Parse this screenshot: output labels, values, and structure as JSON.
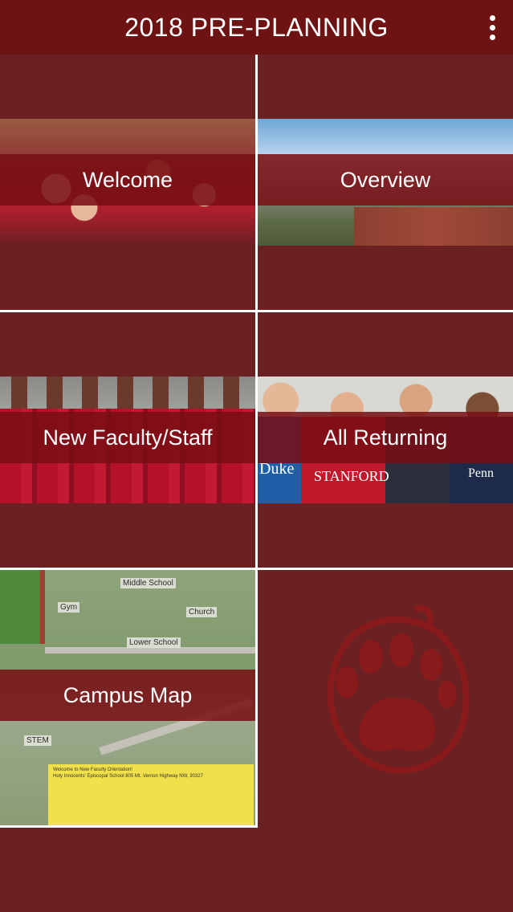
{
  "header": {
    "title": "2018 PRE-PLANNING",
    "menu_icon": "more-vertical-icon"
  },
  "tiles": [
    {
      "label": "Welcome"
    },
    {
      "label": "Overview"
    },
    {
      "label": "New Faculty/Staff"
    },
    {
      "label": "All Returning"
    },
    {
      "label": "Campus Map"
    }
  ],
  "returning_shirts": [
    "Duke",
    "STANFORD",
    "Penn"
  ],
  "map": {
    "labels": [
      "Middle School",
      "Gym",
      "Church",
      "Lower School",
      "STEM"
    ],
    "note_title": "Welcome to New Faculty Orientation!",
    "note_address": "Holy Innocents' Episcopal School 805 Mt. Vernon Highway NW, 30327"
  },
  "colors": {
    "header_bg": "#6e1313",
    "page_bg": "#6b2121",
    "banner_bg": "#780e14",
    "divider": "#ffffff"
  },
  "decoration": {
    "logo_icon": "bear-paw-icon"
  }
}
